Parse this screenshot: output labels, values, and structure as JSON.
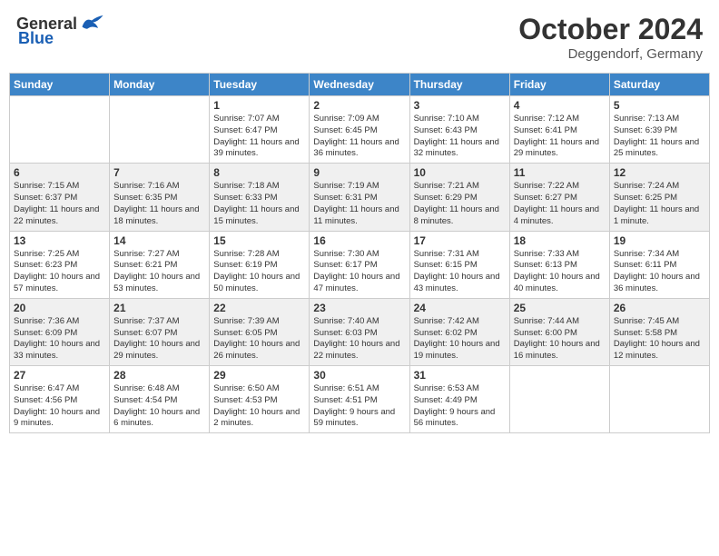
{
  "header": {
    "logo_general": "General",
    "logo_blue": "Blue",
    "month": "October 2024",
    "location": "Deggendorf, Germany"
  },
  "weekdays": [
    "Sunday",
    "Monday",
    "Tuesday",
    "Wednesday",
    "Thursday",
    "Friday",
    "Saturday"
  ],
  "weeks": [
    [
      {
        "day": "",
        "detail": ""
      },
      {
        "day": "",
        "detail": ""
      },
      {
        "day": "1",
        "detail": "Sunrise: 7:07 AM\nSunset: 6:47 PM\nDaylight: 11 hours and 39 minutes."
      },
      {
        "day": "2",
        "detail": "Sunrise: 7:09 AM\nSunset: 6:45 PM\nDaylight: 11 hours and 36 minutes."
      },
      {
        "day": "3",
        "detail": "Sunrise: 7:10 AM\nSunset: 6:43 PM\nDaylight: 11 hours and 32 minutes."
      },
      {
        "day": "4",
        "detail": "Sunrise: 7:12 AM\nSunset: 6:41 PM\nDaylight: 11 hours and 29 minutes."
      },
      {
        "day": "5",
        "detail": "Sunrise: 7:13 AM\nSunset: 6:39 PM\nDaylight: 11 hours and 25 minutes."
      }
    ],
    [
      {
        "day": "6",
        "detail": "Sunrise: 7:15 AM\nSunset: 6:37 PM\nDaylight: 11 hours and 22 minutes."
      },
      {
        "day": "7",
        "detail": "Sunrise: 7:16 AM\nSunset: 6:35 PM\nDaylight: 11 hours and 18 minutes."
      },
      {
        "day": "8",
        "detail": "Sunrise: 7:18 AM\nSunset: 6:33 PM\nDaylight: 11 hours and 15 minutes."
      },
      {
        "day": "9",
        "detail": "Sunrise: 7:19 AM\nSunset: 6:31 PM\nDaylight: 11 hours and 11 minutes."
      },
      {
        "day": "10",
        "detail": "Sunrise: 7:21 AM\nSunset: 6:29 PM\nDaylight: 11 hours and 8 minutes."
      },
      {
        "day": "11",
        "detail": "Sunrise: 7:22 AM\nSunset: 6:27 PM\nDaylight: 11 hours and 4 minutes."
      },
      {
        "day": "12",
        "detail": "Sunrise: 7:24 AM\nSunset: 6:25 PM\nDaylight: 11 hours and 1 minute."
      }
    ],
    [
      {
        "day": "13",
        "detail": "Sunrise: 7:25 AM\nSunset: 6:23 PM\nDaylight: 10 hours and 57 minutes."
      },
      {
        "day": "14",
        "detail": "Sunrise: 7:27 AM\nSunset: 6:21 PM\nDaylight: 10 hours and 53 minutes."
      },
      {
        "day": "15",
        "detail": "Sunrise: 7:28 AM\nSunset: 6:19 PM\nDaylight: 10 hours and 50 minutes."
      },
      {
        "day": "16",
        "detail": "Sunrise: 7:30 AM\nSunset: 6:17 PM\nDaylight: 10 hours and 47 minutes."
      },
      {
        "day": "17",
        "detail": "Sunrise: 7:31 AM\nSunset: 6:15 PM\nDaylight: 10 hours and 43 minutes."
      },
      {
        "day": "18",
        "detail": "Sunrise: 7:33 AM\nSunset: 6:13 PM\nDaylight: 10 hours and 40 minutes."
      },
      {
        "day": "19",
        "detail": "Sunrise: 7:34 AM\nSunset: 6:11 PM\nDaylight: 10 hours and 36 minutes."
      }
    ],
    [
      {
        "day": "20",
        "detail": "Sunrise: 7:36 AM\nSunset: 6:09 PM\nDaylight: 10 hours and 33 minutes."
      },
      {
        "day": "21",
        "detail": "Sunrise: 7:37 AM\nSunset: 6:07 PM\nDaylight: 10 hours and 29 minutes."
      },
      {
        "day": "22",
        "detail": "Sunrise: 7:39 AM\nSunset: 6:05 PM\nDaylight: 10 hours and 26 minutes."
      },
      {
        "day": "23",
        "detail": "Sunrise: 7:40 AM\nSunset: 6:03 PM\nDaylight: 10 hours and 22 minutes."
      },
      {
        "day": "24",
        "detail": "Sunrise: 7:42 AM\nSunset: 6:02 PM\nDaylight: 10 hours and 19 minutes."
      },
      {
        "day": "25",
        "detail": "Sunrise: 7:44 AM\nSunset: 6:00 PM\nDaylight: 10 hours and 16 minutes."
      },
      {
        "day": "26",
        "detail": "Sunrise: 7:45 AM\nSunset: 5:58 PM\nDaylight: 10 hours and 12 minutes."
      }
    ],
    [
      {
        "day": "27",
        "detail": "Sunrise: 6:47 AM\nSunset: 4:56 PM\nDaylight: 10 hours and 9 minutes."
      },
      {
        "day": "28",
        "detail": "Sunrise: 6:48 AM\nSunset: 4:54 PM\nDaylight: 10 hours and 6 minutes."
      },
      {
        "day": "29",
        "detail": "Sunrise: 6:50 AM\nSunset: 4:53 PM\nDaylight: 10 hours and 2 minutes."
      },
      {
        "day": "30",
        "detail": "Sunrise: 6:51 AM\nSunset: 4:51 PM\nDaylight: 9 hours and 59 minutes."
      },
      {
        "day": "31",
        "detail": "Sunrise: 6:53 AM\nSunset: 4:49 PM\nDaylight: 9 hours and 56 minutes."
      },
      {
        "day": "",
        "detail": ""
      },
      {
        "day": "",
        "detail": ""
      }
    ]
  ]
}
